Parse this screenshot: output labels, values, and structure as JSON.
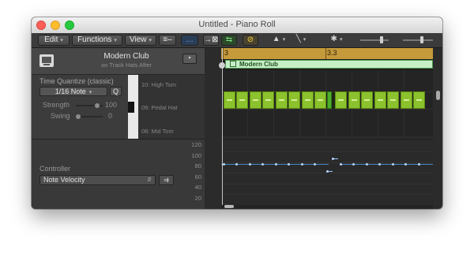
{
  "window": {
    "title": "Untitled - Piano Roll"
  },
  "toolbar": {
    "edit_label": "Edit",
    "functions_label": "Functions",
    "view_label": "View",
    "list_view_glyph": "≡–",
    "tool_1_glyph": "…",
    "tool_2_glyph": "→⊠",
    "tool_3_glyph": "⇆",
    "link_glyph": "⊘",
    "pointer_glyph": "▲",
    "pencil_glyph": "╲",
    "gear_glyph": "✱",
    "chevron": "▾"
  },
  "track": {
    "name": "Modern Club",
    "sub": "on Track Hats After",
    "menu_glyph": "▾"
  },
  "time_quantize": {
    "title": "Time Quantize (classic)",
    "value": "1/16 Note",
    "q_label": "Q",
    "strength_label": "Strength",
    "strength_value": "100",
    "swing_label": "Swing",
    "swing_value": "0"
  },
  "note_names": [
    "10: High Tom",
    "09: Pedal Hat",
    "08: Mid Tom"
  ],
  "controller": {
    "label": "Controller",
    "selected": "Note Velocity",
    "arrow_glyph": "⇵",
    "button_glyph": "⇉"
  },
  "velocity_scale": [
    "120",
    "100",
    "80",
    "60",
    "40",
    "20"
  ],
  "ruler": {
    "bars": [
      "3",
      "3.3"
    ]
  },
  "region": {
    "name": "Modern Club"
  },
  "colors": {
    "note": "#8bc22d",
    "region": "#c7efc7",
    "ruler": "#c59a3a",
    "velocity": "#4a86c7"
  }
}
